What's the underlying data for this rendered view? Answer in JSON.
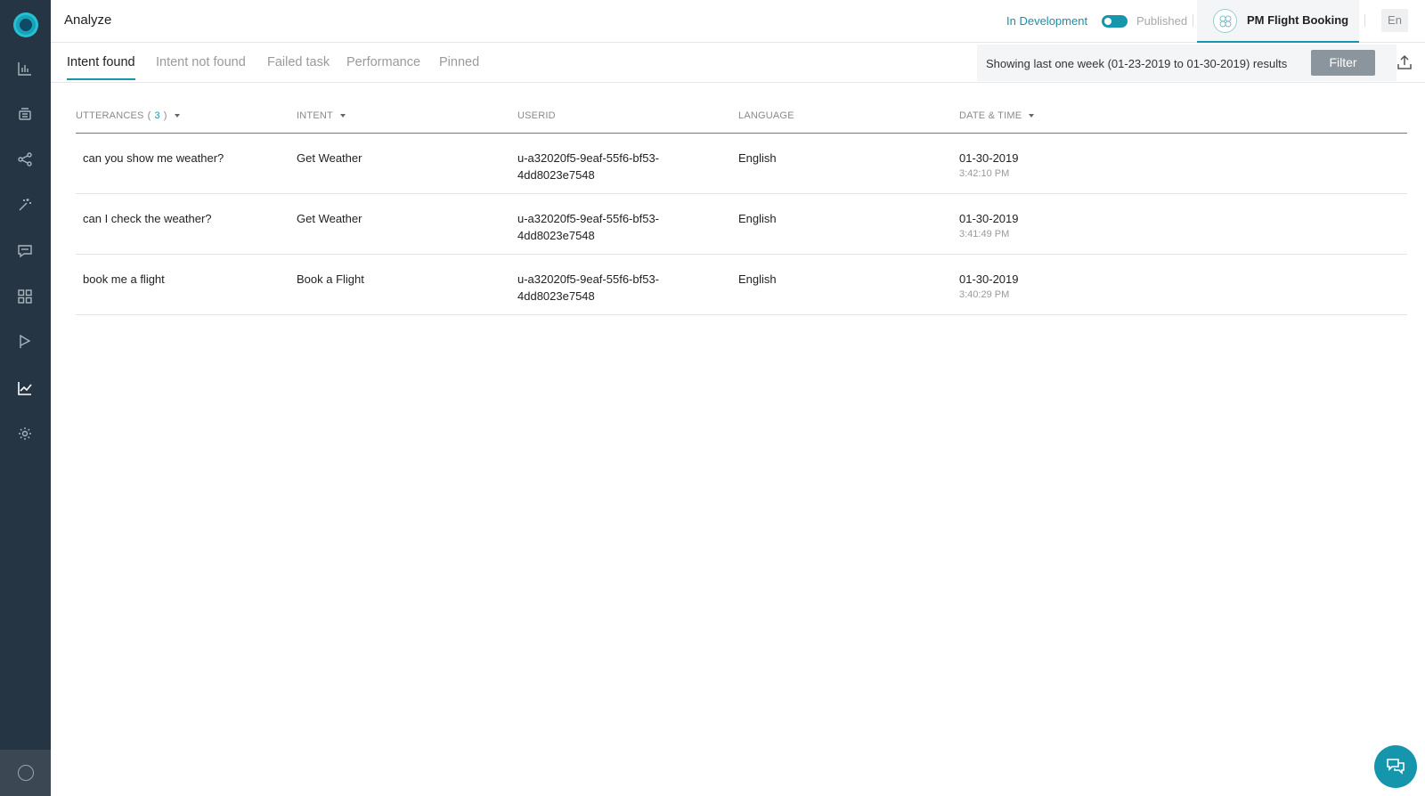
{
  "header": {
    "title": "Analyze",
    "env_dev": "In Development",
    "env_pub": "Published",
    "bot_name": "PM Flight Booking",
    "lang": "En"
  },
  "tabs": [
    {
      "label": "Intent found",
      "active": true
    },
    {
      "label": "Intent not found"
    },
    {
      "label": "Failed task"
    },
    {
      "label": "Performance"
    },
    {
      "label": "Pinned"
    }
  ],
  "filter": {
    "text": "Showing last one week (01-23-2019 to 01-30-2019) results",
    "button": "Filter"
  },
  "table": {
    "headers": {
      "utterances": "UTTERANCES",
      "utterances_count": "3",
      "intent": "INTENT",
      "userid": "USERID",
      "language": "LANGUAGE",
      "datetime": "DATE & TIME"
    },
    "rows": [
      {
        "utterance": "can you show me weather?",
        "intent": "Get Weather",
        "userid_1": "u-a32020f5-9eaf-55f6-bf53-",
        "userid_2": "4dd8023e7548",
        "language": "English",
        "date": "01-30-2019",
        "time": "3:42:10 PM"
      },
      {
        "utterance": "can I check the weather?",
        "intent": "Get Weather",
        "userid_1": "u-a32020f5-9eaf-55f6-bf53-",
        "userid_2": "4dd8023e7548",
        "language": "English",
        "date": "01-30-2019",
        "time": "3:41:49 PM"
      },
      {
        "utterance": "book me a flight",
        "intent": "Book a Flight",
        "userid_1": "u-a32020f5-9eaf-55f6-bf53-",
        "userid_2": "4dd8023e7548",
        "language": "English",
        "date": "01-30-2019",
        "time": "3:40:29 PM"
      }
    ]
  },
  "sidebar": {
    "icons": [
      "bar-chart-icon",
      "bot-stack-icon",
      "flow-icon",
      "magic-wand-icon",
      "chat-icon",
      "grid-icon",
      "flag-icon",
      "analytics-icon",
      "gear-icon"
    ]
  },
  "colors": {
    "sidebar": "#263544",
    "accent": "#1596ad",
    "filter_button": "#8b959d"
  }
}
